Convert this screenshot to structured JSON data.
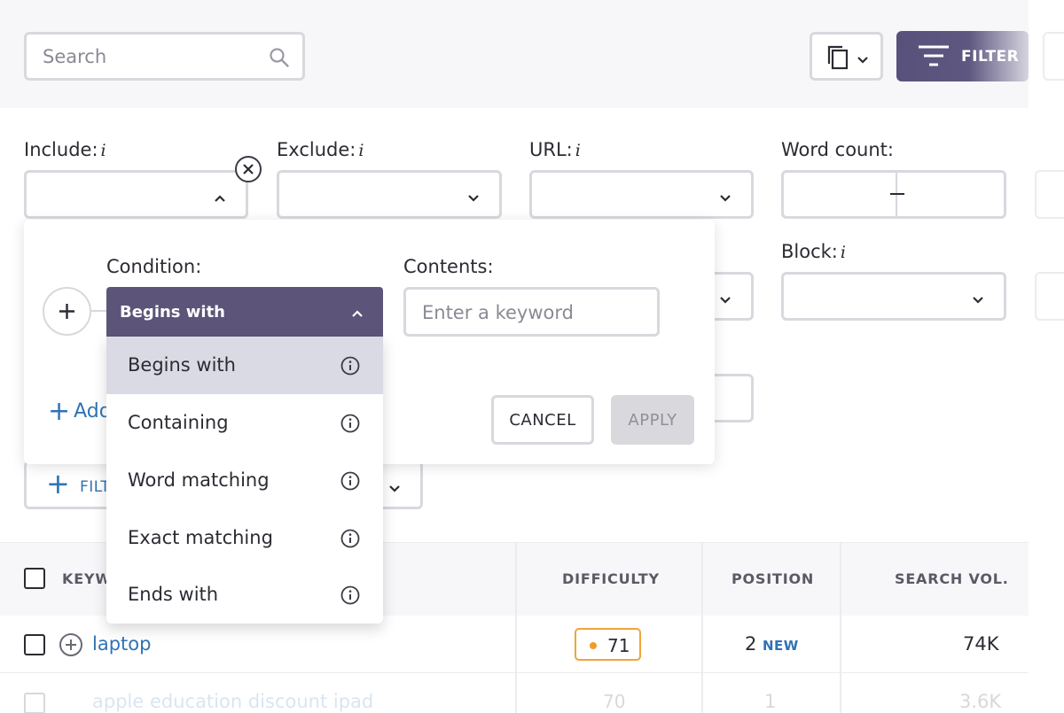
{
  "search": {
    "placeholder": "Search",
    "value": ""
  },
  "toolbar": {
    "filter_label": "FILTER"
  },
  "filters": {
    "include": {
      "label": "Include:",
      "info": "i"
    },
    "exclude": {
      "label": "Exclude:",
      "info": "i"
    },
    "url": {
      "label": "URL:",
      "info": "i"
    },
    "word_count": {
      "label": "Word count:"
    },
    "block": {
      "label": "Block:",
      "info": "i"
    }
  },
  "popup": {
    "condition_label": "Condition:",
    "contents_label": "Contents:",
    "condition_value": "Begins with",
    "keyword_placeholder": "Enter a keyword",
    "add_label": "Add",
    "cancel_label": "CANCEL",
    "apply_label": "APPLY"
  },
  "dropdown": {
    "options": [
      "Begins with",
      "Containing",
      "Word matching",
      "Exact matching",
      "Ends with"
    ],
    "selected": "Begins with"
  },
  "filter_button_partial": "FILT",
  "table": {
    "columns": {
      "keyword": "KEYW",
      "difficulty": "DIFFICULTY",
      "position": "POSITION",
      "search_vol": "SEARCH VOL."
    },
    "rows": [
      {
        "keyword": "laptop",
        "difficulty": "71",
        "position": "2",
        "position_tag": "NEW",
        "search_vol": "74K"
      },
      {
        "keyword": "apple education discount ipad",
        "difficulty": "70",
        "position": "1",
        "search_vol": "3.6K"
      }
    ]
  },
  "colors": {
    "primary": "#5c5579",
    "link": "#2f73b5",
    "difficulty_medium": "#f2a33a"
  }
}
